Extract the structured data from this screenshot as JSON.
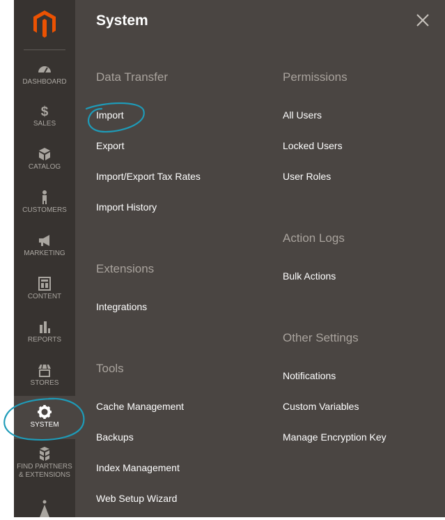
{
  "sidebar": {
    "items": [
      {
        "label": "DASHBOARD",
        "icon": "dashboard-icon"
      },
      {
        "label": "SALES",
        "icon": "dollar-icon"
      },
      {
        "label": "CATALOG",
        "icon": "box-icon"
      },
      {
        "label": "CUSTOMERS",
        "icon": "person-icon"
      },
      {
        "label": "MARKETING",
        "icon": "megaphone-icon"
      },
      {
        "label": "CONTENT",
        "icon": "layout-icon"
      },
      {
        "label": "REPORTS",
        "icon": "bar-chart-icon"
      },
      {
        "label": "STORES",
        "icon": "storefront-icon"
      },
      {
        "label": "SYSTEM",
        "icon": "gear-icon"
      },
      {
        "label": "FIND PARTNERS\n& EXTENSIONS",
        "icon": "cubes-icon"
      }
    ]
  },
  "panel": {
    "title": "System",
    "sections": {
      "data_transfer": {
        "title": "Data Transfer",
        "links": [
          "Import",
          "Export",
          "Import/Export Tax Rates",
          "Import History"
        ]
      },
      "extensions": {
        "title": "Extensions",
        "links": [
          "Integrations"
        ]
      },
      "tools": {
        "title": "Tools",
        "links": [
          "Cache Management",
          "Backups",
          "Index Management",
          "Web Setup Wizard"
        ]
      },
      "permissions": {
        "title": "Permissions",
        "links": [
          "All Users",
          "Locked Users",
          "User Roles"
        ]
      },
      "action_logs": {
        "title": "Action Logs",
        "links": [
          "Bulk Actions"
        ]
      },
      "other_settings": {
        "title": "Other Settings",
        "links": [
          "Notifications",
          "Custom Variables",
          "Manage Encryption Key"
        ]
      }
    }
  },
  "colors": {
    "sidebar_bg": "#373330",
    "panel_bg": "#4a4542",
    "accent": "#eb5202",
    "annotation": "#1e9bb8"
  }
}
